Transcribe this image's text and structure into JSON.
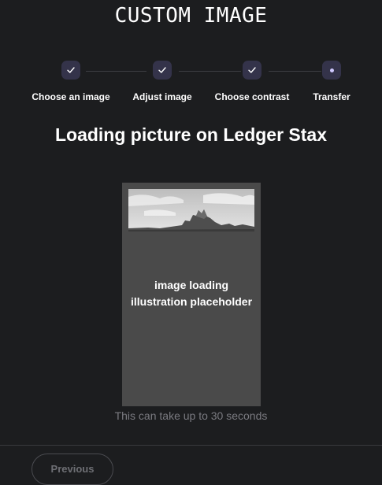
{
  "header": {
    "title": "CUSTOM IMAGE"
  },
  "stepper": {
    "steps": [
      {
        "label": "Choose an image",
        "status": "completed",
        "icon": "check-icon"
      },
      {
        "label": "Adjust image",
        "status": "completed",
        "icon": "check-icon"
      },
      {
        "label": "Choose contrast",
        "status": "completed",
        "icon": "check-icon"
      },
      {
        "label": "Transfer",
        "status": "current",
        "icon": "dot-icon"
      }
    ]
  },
  "main": {
    "headline": "Loading picture on Ledger Stax",
    "placeholder_line1": "image loading",
    "placeholder_line2": "illustration placeholder",
    "hint": "This can take up to 30 seconds"
  },
  "footer": {
    "previous_label": "Previous"
  },
  "colors": {
    "background": "#1c1d1f",
    "step_badge": "#34334a",
    "accent": "#cfc9ff",
    "device_body": "#4a4a4a",
    "muted_text": "#7a7a80"
  }
}
